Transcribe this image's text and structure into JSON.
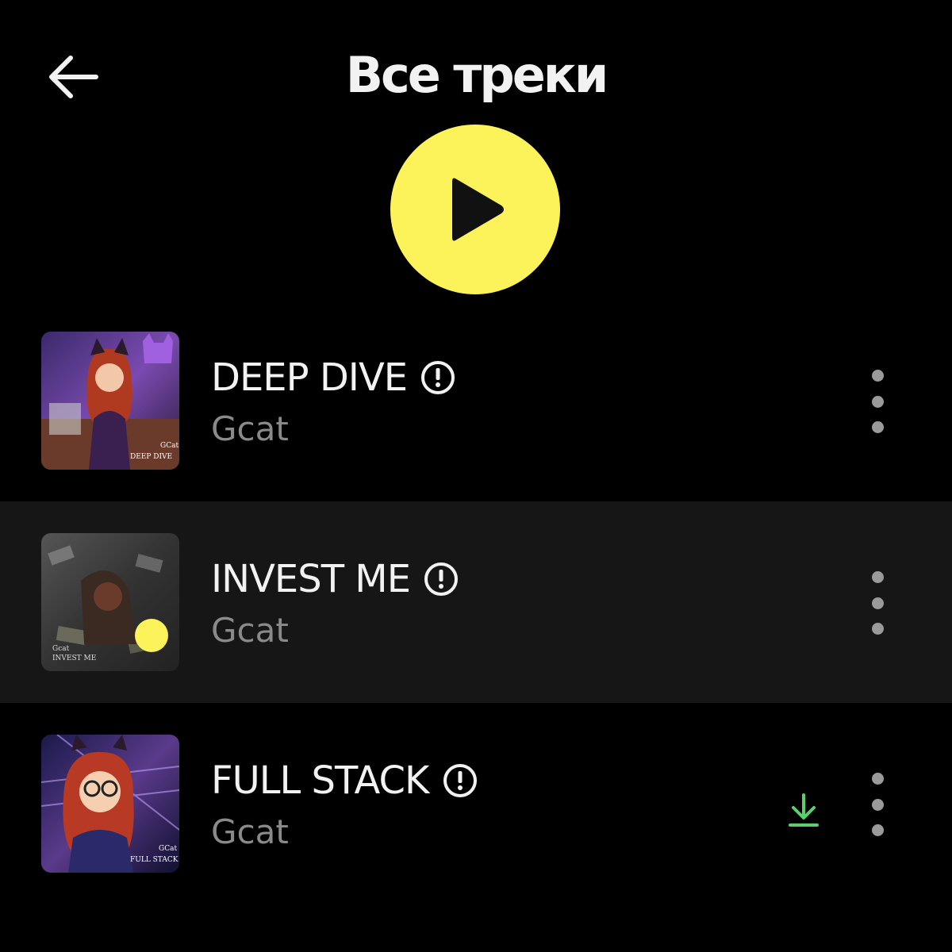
{
  "header": {
    "title": "Все треки",
    "back_icon": "arrow-left-icon"
  },
  "play_all": {
    "icon": "play-icon",
    "color": "#fcf35a"
  },
  "tracks": [
    {
      "title": "DEEP DIVE",
      "artist": "Gcat",
      "explicit": true,
      "downloaded": false,
      "playing": false,
      "cover_caption_1": "GCat",
      "cover_caption_2": "DEEP DIVE"
    },
    {
      "title": "INVEST ME",
      "artist": "Gcat",
      "explicit": true,
      "downloaded": false,
      "playing": true,
      "cover_caption_1": "Gcat",
      "cover_caption_2": "INVEST ME"
    },
    {
      "title": "FULL STACK",
      "artist": "Gcat",
      "explicit": true,
      "downloaded": true,
      "playing": false,
      "cover_caption_1": "GCat",
      "cover_caption_2": "FULL STACK"
    }
  ],
  "colors": {
    "accent": "#fcf35a",
    "downloaded": "#5ccf6a",
    "highlight_row": "#161616"
  }
}
